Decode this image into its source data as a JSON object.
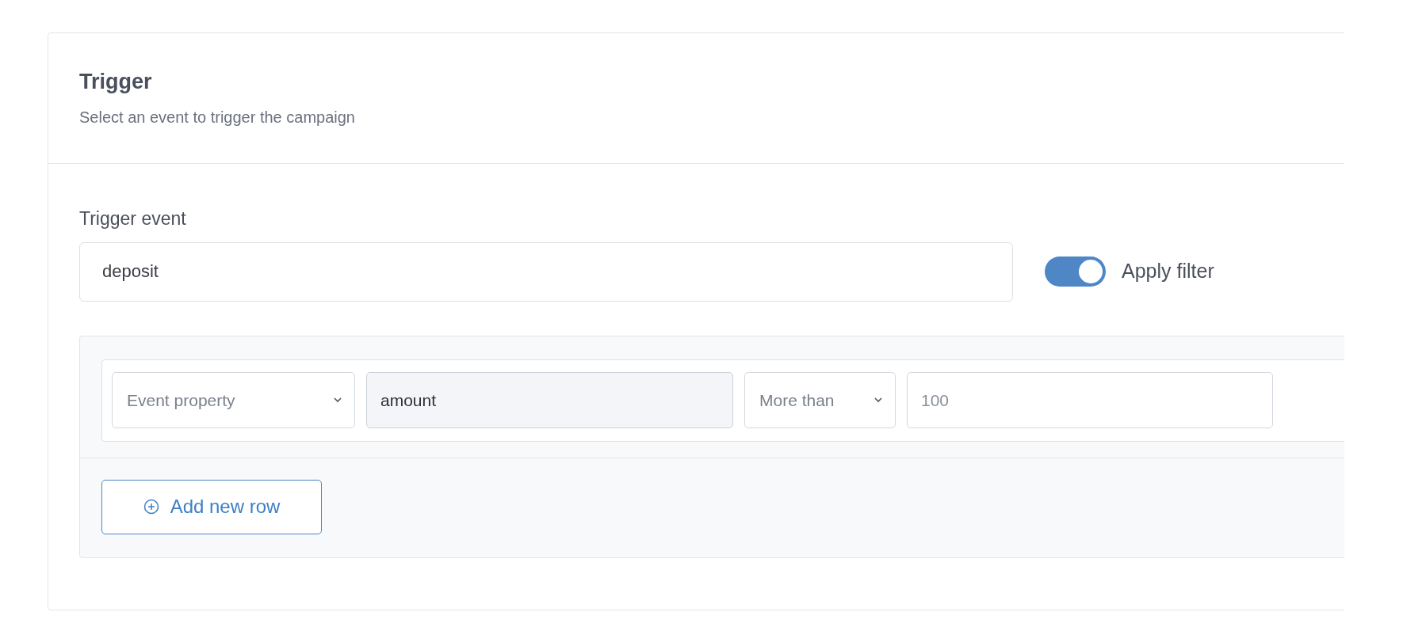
{
  "card": {
    "title": "Trigger",
    "subtitle": "Select an event to trigger the campaign"
  },
  "trigger_event": {
    "label": "Trigger event",
    "value": "deposit"
  },
  "apply_filter": {
    "label": "Apply filter",
    "on": true
  },
  "filter_rows": [
    {
      "fields": [
        {
          "kind": "select",
          "placeholder": "Event property"
        },
        {
          "kind": "readonly",
          "value": "amount"
        },
        {
          "kind": "select",
          "placeholder": "More than"
        },
        {
          "kind": "input",
          "placeholder": "100"
        }
      ]
    }
  ],
  "add_row_button": {
    "label": "Add new row"
  }
}
